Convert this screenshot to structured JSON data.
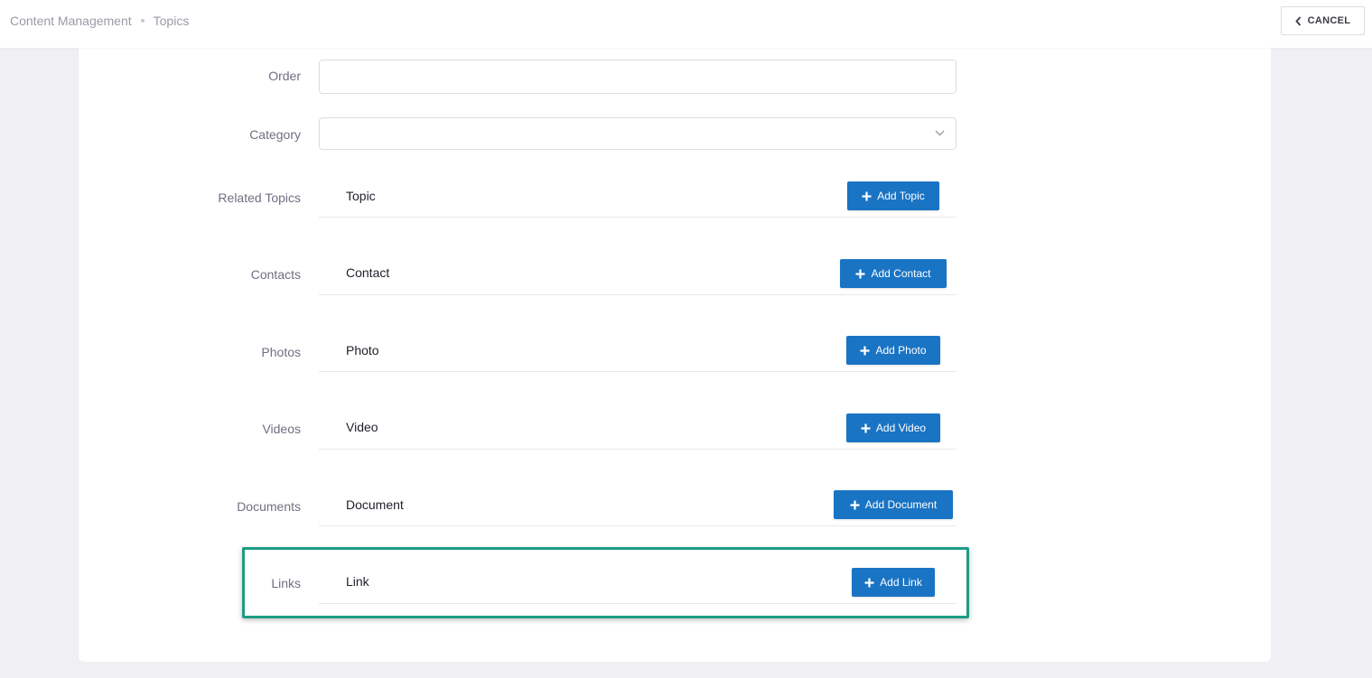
{
  "breadcrumb": {
    "items": [
      "Content Management",
      "Topics"
    ]
  },
  "header": {
    "cancel_label": "CANCEL"
  },
  "form": {
    "order": {
      "label": "Order",
      "value": ""
    },
    "category": {
      "label": "Category",
      "value": ""
    },
    "sections": [
      {
        "label": "Related Topics",
        "title": "Topic",
        "button": "Add Topic"
      },
      {
        "label": "Contacts",
        "title": "Contact",
        "button": "Add Contact"
      },
      {
        "label": "Photos",
        "title": "Photo",
        "button": "Add Photo"
      },
      {
        "label": "Videos",
        "title": "Video",
        "button": "Add Video"
      },
      {
        "label": "Documents",
        "title": "Document",
        "button": "Add Document"
      },
      {
        "label": "Links",
        "title": "Link",
        "button": "Add Link"
      }
    ]
  },
  "icons": {
    "cancel": "chevron-left-icon",
    "dropdown": "chevron-down-icon",
    "add": "plus-icon"
  },
  "colors": {
    "primary": "#1a74c4",
    "highlight": "#1e9b85",
    "background": "#f0f0f4"
  }
}
